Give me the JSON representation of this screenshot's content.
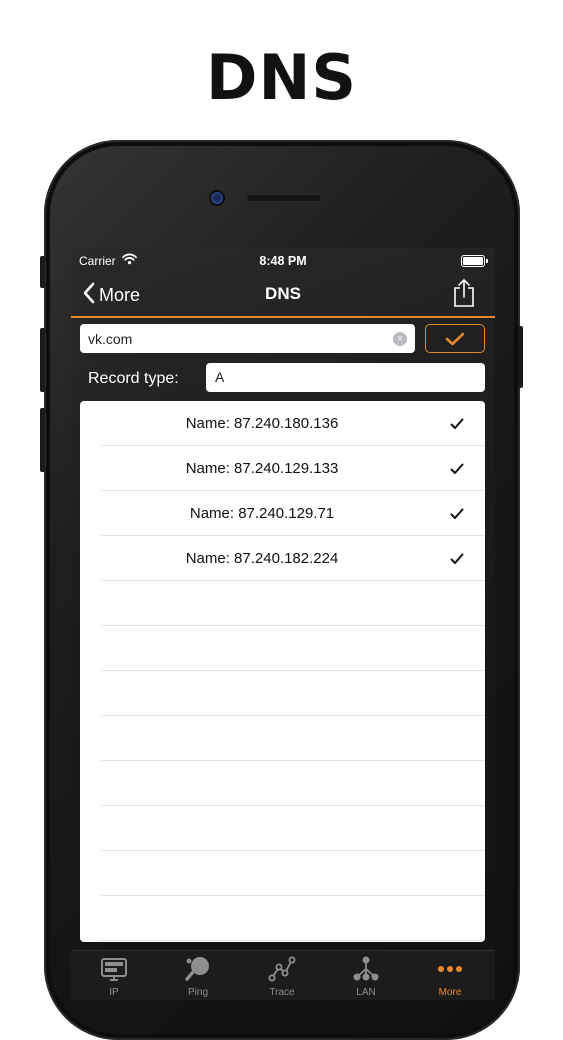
{
  "promo": {
    "title": "DNS"
  },
  "status_bar": {
    "carrier": "Carrier",
    "time": "8:48 PM"
  },
  "nav": {
    "back_label": "More",
    "title": "DNS"
  },
  "query": {
    "host_value": "vk.com",
    "record_type_label": "Record type:",
    "record_type_value": "A"
  },
  "results": [
    {
      "text": "Name: 87.240.180.136",
      "checked": true
    },
    {
      "text": "Name: 87.240.129.133",
      "checked": true
    },
    {
      "text": "Name: 87.240.129.71",
      "checked": true
    },
    {
      "text": "Name: 87.240.182.224",
      "checked": true
    }
  ],
  "tabs": [
    {
      "label": "IP",
      "icon": "monitor-icon",
      "active": false
    },
    {
      "label": "Ping",
      "icon": "ping-pong-icon",
      "active": false
    },
    {
      "label": "Trace",
      "icon": "trace-icon",
      "active": false
    },
    {
      "label": "LAN",
      "icon": "lan-icon",
      "active": false
    },
    {
      "label": "More",
      "icon": "more-dots-icon",
      "active": true
    }
  ],
  "colors": {
    "accent": "#e0892f",
    "tab_inactive": "#8e8e8e"
  }
}
